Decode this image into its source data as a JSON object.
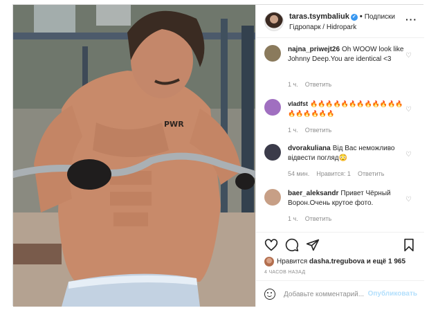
{
  "header": {
    "username": "taras.tsymbaliuk",
    "verified_glyph": "✓",
    "separator": "•",
    "follow_label": "Подписки",
    "location": "Гідропарк / Hidropark",
    "more_glyph": "···"
  },
  "photo": {
    "tattoo_text": "PWR"
  },
  "comments": [
    {
      "username": "najna_priwejt26",
      "text": "Oh WOOW look like Johnny Deep.You are identical <3",
      "time": "1 ч.",
      "reply": "Ответить",
      "avatar_color": "#8a7a5c"
    },
    {
      "username": "vladfst",
      "text": "🔥🔥🔥🔥🔥🔥🔥🔥🔥🔥🔥🔥🔥🔥🔥🔥🔥🔥",
      "time": "1 ч.",
      "reply": "Ответить",
      "avatar_color": "#a06fc0"
    },
    {
      "username": "dvorakuliana",
      "text": "Від Вас неможливо відвести погляд😳",
      "time": "54 мин.",
      "likes": "Нравится: 1",
      "reply": "Ответить",
      "avatar_color": "#3b3b4a"
    },
    {
      "username": "baer_aleksandr",
      "text": "Привет Чёрный Ворон.Очень крутое фото.",
      "time": "1 ч.",
      "reply": "Ответить",
      "avatar_color": "#c79f86"
    }
  ],
  "actions": {
    "icons": [
      "heart-icon",
      "comment-icon",
      "share-icon",
      "save-icon"
    ]
  },
  "likes": {
    "prefix": "Нравится",
    "user": "dasha.tregubova",
    "suffix": "и ещё 1 965"
  },
  "timestamp": "4 ЧАСОВ НАЗАД",
  "add_comment": {
    "placeholder": "Добавьте комментарий...",
    "publish_label": "Опубликовать"
  },
  "colors": {
    "verified": "#3897f0",
    "secondary_text": "#8e8e8e",
    "publish_disabled": "#b2dffc"
  }
}
